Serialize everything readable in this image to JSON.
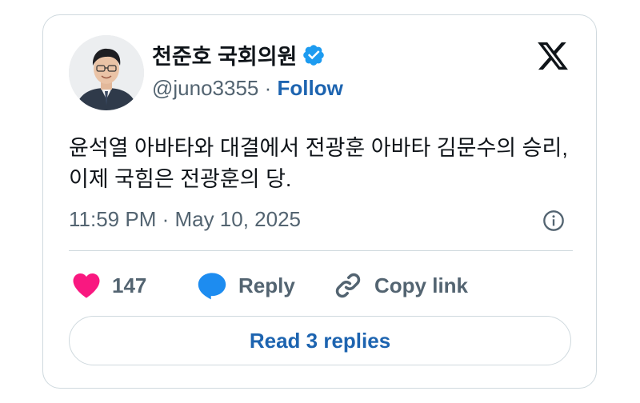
{
  "author": {
    "display_name": "천준호 국회의원",
    "handle": "@juno3355",
    "separator": "·",
    "follow_label": "Follow",
    "verified_badge_icon": "verified-badge-icon",
    "avatar_icon": "avatar"
  },
  "brand": {
    "logo_icon": "x-logo-icon"
  },
  "tweet": {
    "text_line_1": "윤석열 아바타와 대결에서 전광훈 아바타 김문수의 승리,",
    "text_line_2": "이제 국힘은 전광훈의 당.",
    "timestamp": "11:59 PM · May 10, 2025",
    "info_icon": "info-icon"
  },
  "actions": {
    "like_count": "147",
    "reply_label": "Reply",
    "copy_link_label": "Copy link"
  },
  "footer": {
    "read_replies_label": "Read 3 replies"
  },
  "colors": {
    "link_blue": "#1d64b0",
    "verified_blue": "#1d9bf0",
    "heart_pink": "#f91880",
    "secondary_text": "#536471",
    "primary_text": "#0f1419",
    "border": "#cfd9de"
  }
}
